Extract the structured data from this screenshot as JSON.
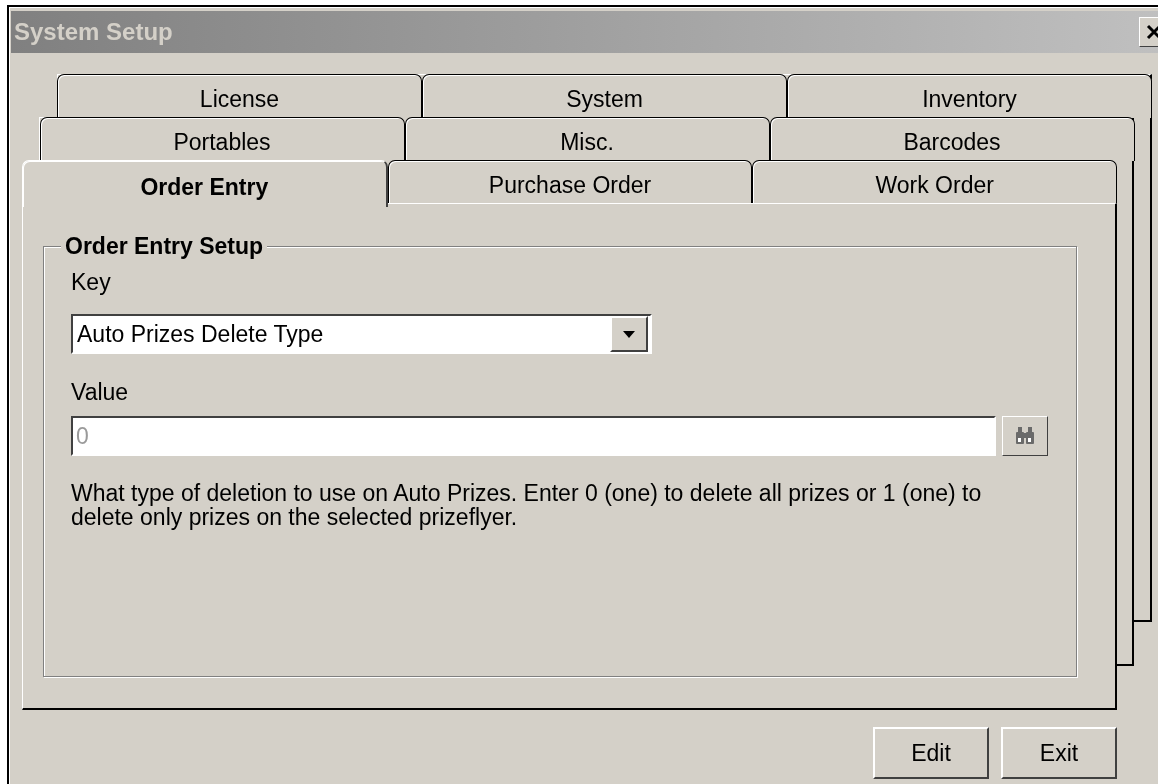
{
  "window": {
    "title": "System Setup"
  },
  "tab_rows": [
    [
      {
        "label": "License",
        "selected": false
      },
      {
        "label": "System",
        "selected": false
      },
      {
        "label": "Inventory",
        "selected": false
      }
    ],
    [
      {
        "label": "Portables",
        "selected": false
      },
      {
        "label": "Misc.",
        "selected": false
      },
      {
        "label": "Barcodes",
        "selected": false
      }
    ],
    [
      {
        "label": "Order Entry",
        "selected": true
      },
      {
        "label": "Purchase Order",
        "selected": false
      },
      {
        "label": "Work Order",
        "selected": false
      }
    ]
  ],
  "group": {
    "title": "Order Entry Setup",
    "key_label": {
      "text": "Key"
    },
    "key_combo": {
      "value": "Auto Prizes Delete Type"
    },
    "value_label": {
      "text": "Value"
    },
    "value_field": {
      "value": "0",
      "disabled": true
    },
    "description": "What type of deletion to use on Auto Prizes. Enter 0 (one) to delete all prizes or 1 (one) to delete only prizes on the selected prizeflyer."
  },
  "buttons": [
    {
      "label": "Edit"
    },
    {
      "label": "Exit"
    }
  ]
}
